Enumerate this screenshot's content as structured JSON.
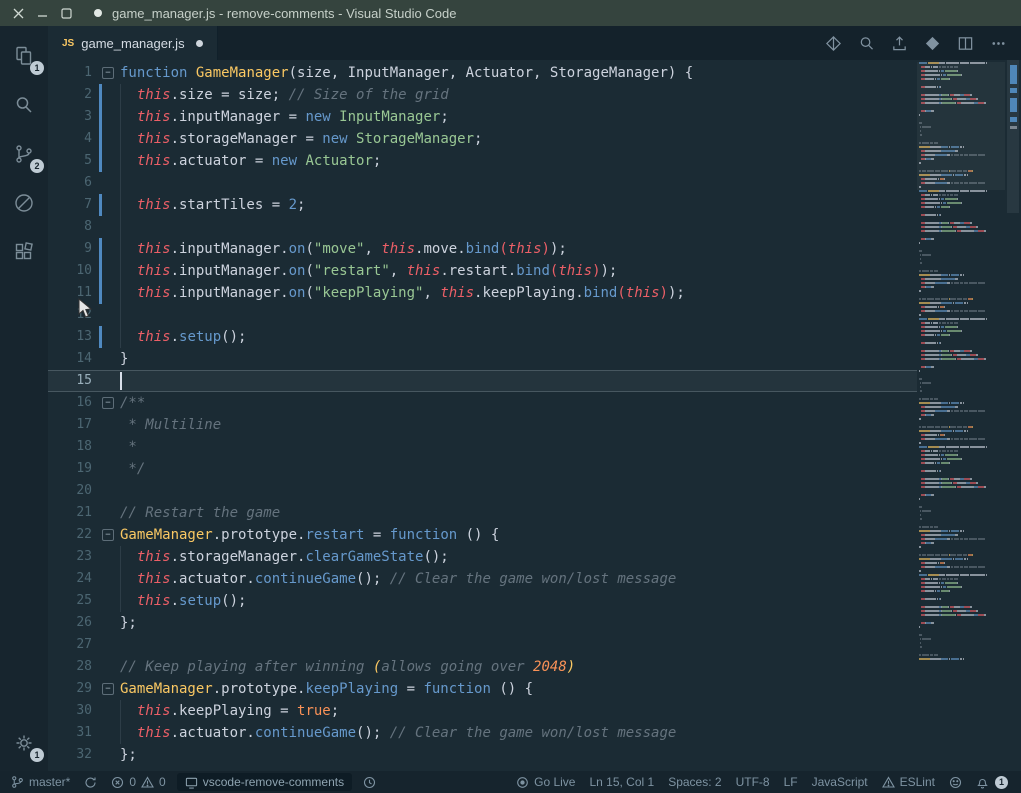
{
  "window": {
    "title": "game_manager.js - remove-comments - Visual Studio Code"
  },
  "activity_bar": {
    "items": [
      "explorer",
      "search",
      "source-control",
      "circle-slash",
      "extensions"
    ],
    "explorer_badge": "1",
    "scm_badge": "2",
    "manage_badge": "1"
  },
  "tab_bar": {
    "tabs": [
      {
        "icon_label": "JS",
        "label": "game_manager.js",
        "modified": true
      }
    ],
    "actions": [
      "open-changes",
      "search-editor",
      "export",
      "run",
      "split-editor",
      "more-actions"
    ]
  },
  "editor": {
    "current_line": 15,
    "cursor": {
      "line": 15,
      "column": 1
    },
    "lines": [
      {
        "n": 1,
        "fold": true,
        "tokens": [
          [
            "k",
            "function"
          ],
          [
            "d",
            " "
          ],
          [
            "f",
            "GameManager"
          ],
          [
            "d",
            "(size, InputManager, Actuator, StorageManager) {"
          ]
        ]
      },
      {
        "n": 2,
        "git": true,
        "guide": true,
        "tokens": [
          [
            "d",
            "  "
          ],
          [
            "t",
            "this"
          ],
          [
            "d",
            ".size = size; "
          ],
          [
            "c",
            "// Size of the grid"
          ]
        ]
      },
      {
        "n": 3,
        "git": true,
        "guide": true,
        "tokens": [
          [
            "d",
            "  "
          ],
          [
            "t",
            "this"
          ],
          [
            "d",
            ".inputManager = "
          ],
          [
            "k",
            "new"
          ],
          [
            "d",
            " "
          ],
          [
            "cl",
            "InputManager"
          ],
          [
            "d",
            ";"
          ]
        ]
      },
      {
        "n": 4,
        "git": true,
        "guide": true,
        "tokens": [
          [
            "d",
            "  "
          ],
          [
            "t",
            "this"
          ],
          [
            "d",
            ".storageManager = "
          ],
          [
            "k",
            "new"
          ],
          [
            "d",
            " "
          ],
          [
            "cl",
            "StorageManager"
          ],
          [
            "d",
            ";"
          ]
        ]
      },
      {
        "n": 5,
        "git": true,
        "guide": true,
        "tokens": [
          [
            "d",
            "  "
          ],
          [
            "t",
            "this"
          ],
          [
            "d",
            ".actuator = "
          ],
          [
            "k",
            "new"
          ],
          [
            "d",
            " "
          ],
          [
            "cl",
            "Actuator"
          ],
          [
            "d",
            ";"
          ]
        ]
      },
      {
        "n": 6,
        "guide": true,
        "tokens": []
      },
      {
        "n": 7,
        "git": true,
        "guide": true,
        "tokens": [
          [
            "d",
            "  "
          ],
          [
            "t",
            "this"
          ],
          [
            "d",
            ".startTiles = "
          ],
          [
            "n",
            "2"
          ],
          [
            "d",
            ";"
          ]
        ]
      },
      {
        "n": 8,
        "guide": true,
        "tokens": []
      },
      {
        "n": 9,
        "git": true,
        "guide": true,
        "tokens": [
          [
            "d",
            "  "
          ],
          [
            "t",
            "this"
          ],
          [
            "d",
            ".inputManager."
          ],
          [
            "m",
            "on"
          ],
          [
            "d",
            "("
          ],
          [
            "s",
            "\"move\""
          ],
          [
            "d",
            ", "
          ],
          [
            "t",
            "this"
          ],
          [
            "d",
            ".move."
          ],
          [
            "m",
            "bind"
          ],
          [
            "rp",
            "("
          ],
          [
            "t",
            "this"
          ],
          [
            "rp",
            ")"
          ],
          [
            "d",
            ");"
          ]
        ]
      },
      {
        "n": 10,
        "git": true,
        "guide": true,
        "tokens": [
          [
            "d",
            "  "
          ],
          [
            "t",
            "this"
          ],
          [
            "d",
            ".inputManager."
          ],
          [
            "m",
            "on"
          ],
          [
            "d",
            "("
          ],
          [
            "s",
            "\"restart\""
          ],
          [
            "d",
            ", "
          ],
          [
            "t",
            "this"
          ],
          [
            "d",
            ".restart."
          ],
          [
            "m",
            "bind"
          ],
          [
            "rp",
            "("
          ],
          [
            "t",
            "this"
          ],
          [
            "rp",
            ")"
          ],
          [
            "d",
            ");"
          ]
        ]
      },
      {
        "n": 11,
        "git": true,
        "guide": true,
        "tokens": [
          [
            "d",
            "  "
          ],
          [
            "t",
            "this"
          ],
          [
            "d",
            ".inputManager."
          ],
          [
            "m",
            "on"
          ],
          [
            "d",
            "("
          ],
          [
            "s",
            "\"keepPlaying\""
          ],
          [
            "d",
            ", "
          ],
          [
            "t",
            "this"
          ],
          [
            "d",
            ".keepPlaying."
          ],
          [
            "m",
            "bind"
          ],
          [
            "rp",
            "("
          ],
          [
            "t",
            "this"
          ],
          [
            "rp",
            ")"
          ],
          [
            "d",
            ");"
          ]
        ]
      },
      {
        "n": 12,
        "guide": true,
        "tokens": []
      },
      {
        "n": 13,
        "git": true,
        "guide": true,
        "tokens": [
          [
            "d",
            "  "
          ],
          [
            "t",
            "this"
          ],
          [
            "d",
            "."
          ],
          [
            "m",
            "setup"
          ],
          [
            "d",
            "();"
          ]
        ]
      },
      {
        "n": 14,
        "tokens": [
          [
            "d",
            "}"
          ]
        ]
      },
      {
        "n": 15,
        "tokens": []
      },
      {
        "n": 16,
        "fold": true,
        "tokens": [
          [
            "c",
            "/**"
          ]
        ]
      },
      {
        "n": 17,
        "tokens": [
          [
            "c",
            " * Multiline"
          ]
        ]
      },
      {
        "n": 18,
        "tokens": [
          [
            "c",
            " *"
          ]
        ]
      },
      {
        "n": 19,
        "tokens": [
          [
            "c",
            " */"
          ]
        ]
      },
      {
        "n": 20,
        "tokens": []
      },
      {
        "n": 21,
        "tokens": [
          [
            "c",
            "// Restart the game"
          ]
        ]
      },
      {
        "n": 22,
        "fold": true,
        "tokens": [
          [
            "f",
            "GameManager"
          ],
          [
            "d",
            ".prototype."
          ],
          [
            "m",
            "restart"
          ],
          [
            "d",
            " = "
          ],
          [
            "k",
            "function"
          ],
          [
            "d",
            " () {"
          ]
        ]
      },
      {
        "n": 23,
        "guide": true,
        "tokens": [
          [
            "d",
            "  "
          ],
          [
            "t",
            "this"
          ],
          [
            "d",
            ".storageManager."
          ],
          [
            "m",
            "clearGameState"
          ],
          [
            "d",
            "();"
          ]
        ]
      },
      {
        "n": 24,
        "guide": true,
        "tokens": [
          [
            "d",
            "  "
          ],
          [
            "t",
            "this"
          ],
          [
            "d",
            ".actuator."
          ],
          [
            "m",
            "continueGame"
          ],
          [
            "d",
            "(); "
          ],
          [
            "c",
            "// Clear the game won/lost message"
          ]
        ]
      },
      {
        "n": 25,
        "guide": true,
        "tokens": [
          [
            "d",
            "  "
          ],
          [
            "t",
            "this"
          ],
          [
            "d",
            "."
          ],
          [
            "m",
            "setup"
          ],
          [
            "d",
            "();"
          ]
        ]
      },
      {
        "n": 26,
        "tokens": [
          [
            "d",
            "};"
          ]
        ]
      },
      {
        "n": 27,
        "tokens": []
      },
      {
        "n": 28,
        "tokens": [
          [
            "c",
            "// Keep playing after winning "
          ],
          [
            "cy",
            "("
          ],
          [
            "c",
            "allows going over "
          ],
          [
            "cn",
            "2048"
          ],
          [
            "cy",
            ")"
          ]
        ]
      },
      {
        "n": 29,
        "fold": true,
        "tokens": [
          [
            "f",
            "GameManager"
          ],
          [
            "d",
            ".prototype."
          ],
          [
            "m",
            "keepPlaying"
          ],
          [
            "d",
            " = "
          ],
          [
            "k",
            "function"
          ],
          [
            "d",
            " () {"
          ]
        ]
      },
      {
        "n": 30,
        "guide": true,
        "tokens": [
          [
            "d",
            "  "
          ],
          [
            "t",
            "this"
          ],
          [
            "d",
            ".keepPlaying = "
          ],
          [
            "b",
            "true"
          ],
          [
            "d",
            ";"
          ]
        ]
      },
      {
        "n": 31,
        "guide": true,
        "tokens": [
          [
            "d",
            "  "
          ],
          [
            "t",
            "this"
          ],
          [
            "d",
            ".actuator."
          ],
          [
            "m",
            "continueGame"
          ],
          [
            "d",
            "(); "
          ],
          [
            "c",
            "// Clear the game won/lost message"
          ]
        ]
      },
      {
        "n": 32,
        "tokens": [
          [
            "d",
            "};"
          ]
        ]
      }
    ]
  },
  "status_bar": {
    "branch": "master*",
    "errors": "0",
    "warnings": "0",
    "task": "vscode-remove-comments",
    "go_live": "Go Live",
    "position": "Ln 15, Col 1",
    "indentation": "Spaces: 2",
    "encoding": "UTF-8",
    "eol": "LF",
    "language": "JavaScript",
    "linter": "ESLint",
    "notifications": "1"
  },
  "colors": {
    "editor_bg": "#1b2b34",
    "titlebar_bg": "#35443e",
    "activitybar_bg": "#17252e",
    "statusbar_bg": "#16242d",
    "keyword_blue": "#6699cc",
    "this_red": "#ec5f67",
    "function_yellow": "#fac863",
    "string_green": "#99c794",
    "constant_orange": "#f99157",
    "comment_gray": "#65737e",
    "foreground": "#cdd3de",
    "git_modified": "#5089c0"
  }
}
